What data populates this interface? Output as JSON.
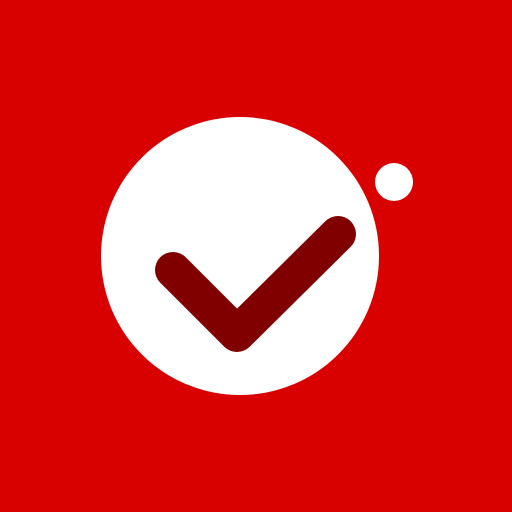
{
  "icon": {
    "name": "checkmark-logo-icon",
    "colors": {
      "background": "#d90000",
      "circle": "#ffffff",
      "dot": "#ffffff",
      "check": "#800000"
    }
  }
}
